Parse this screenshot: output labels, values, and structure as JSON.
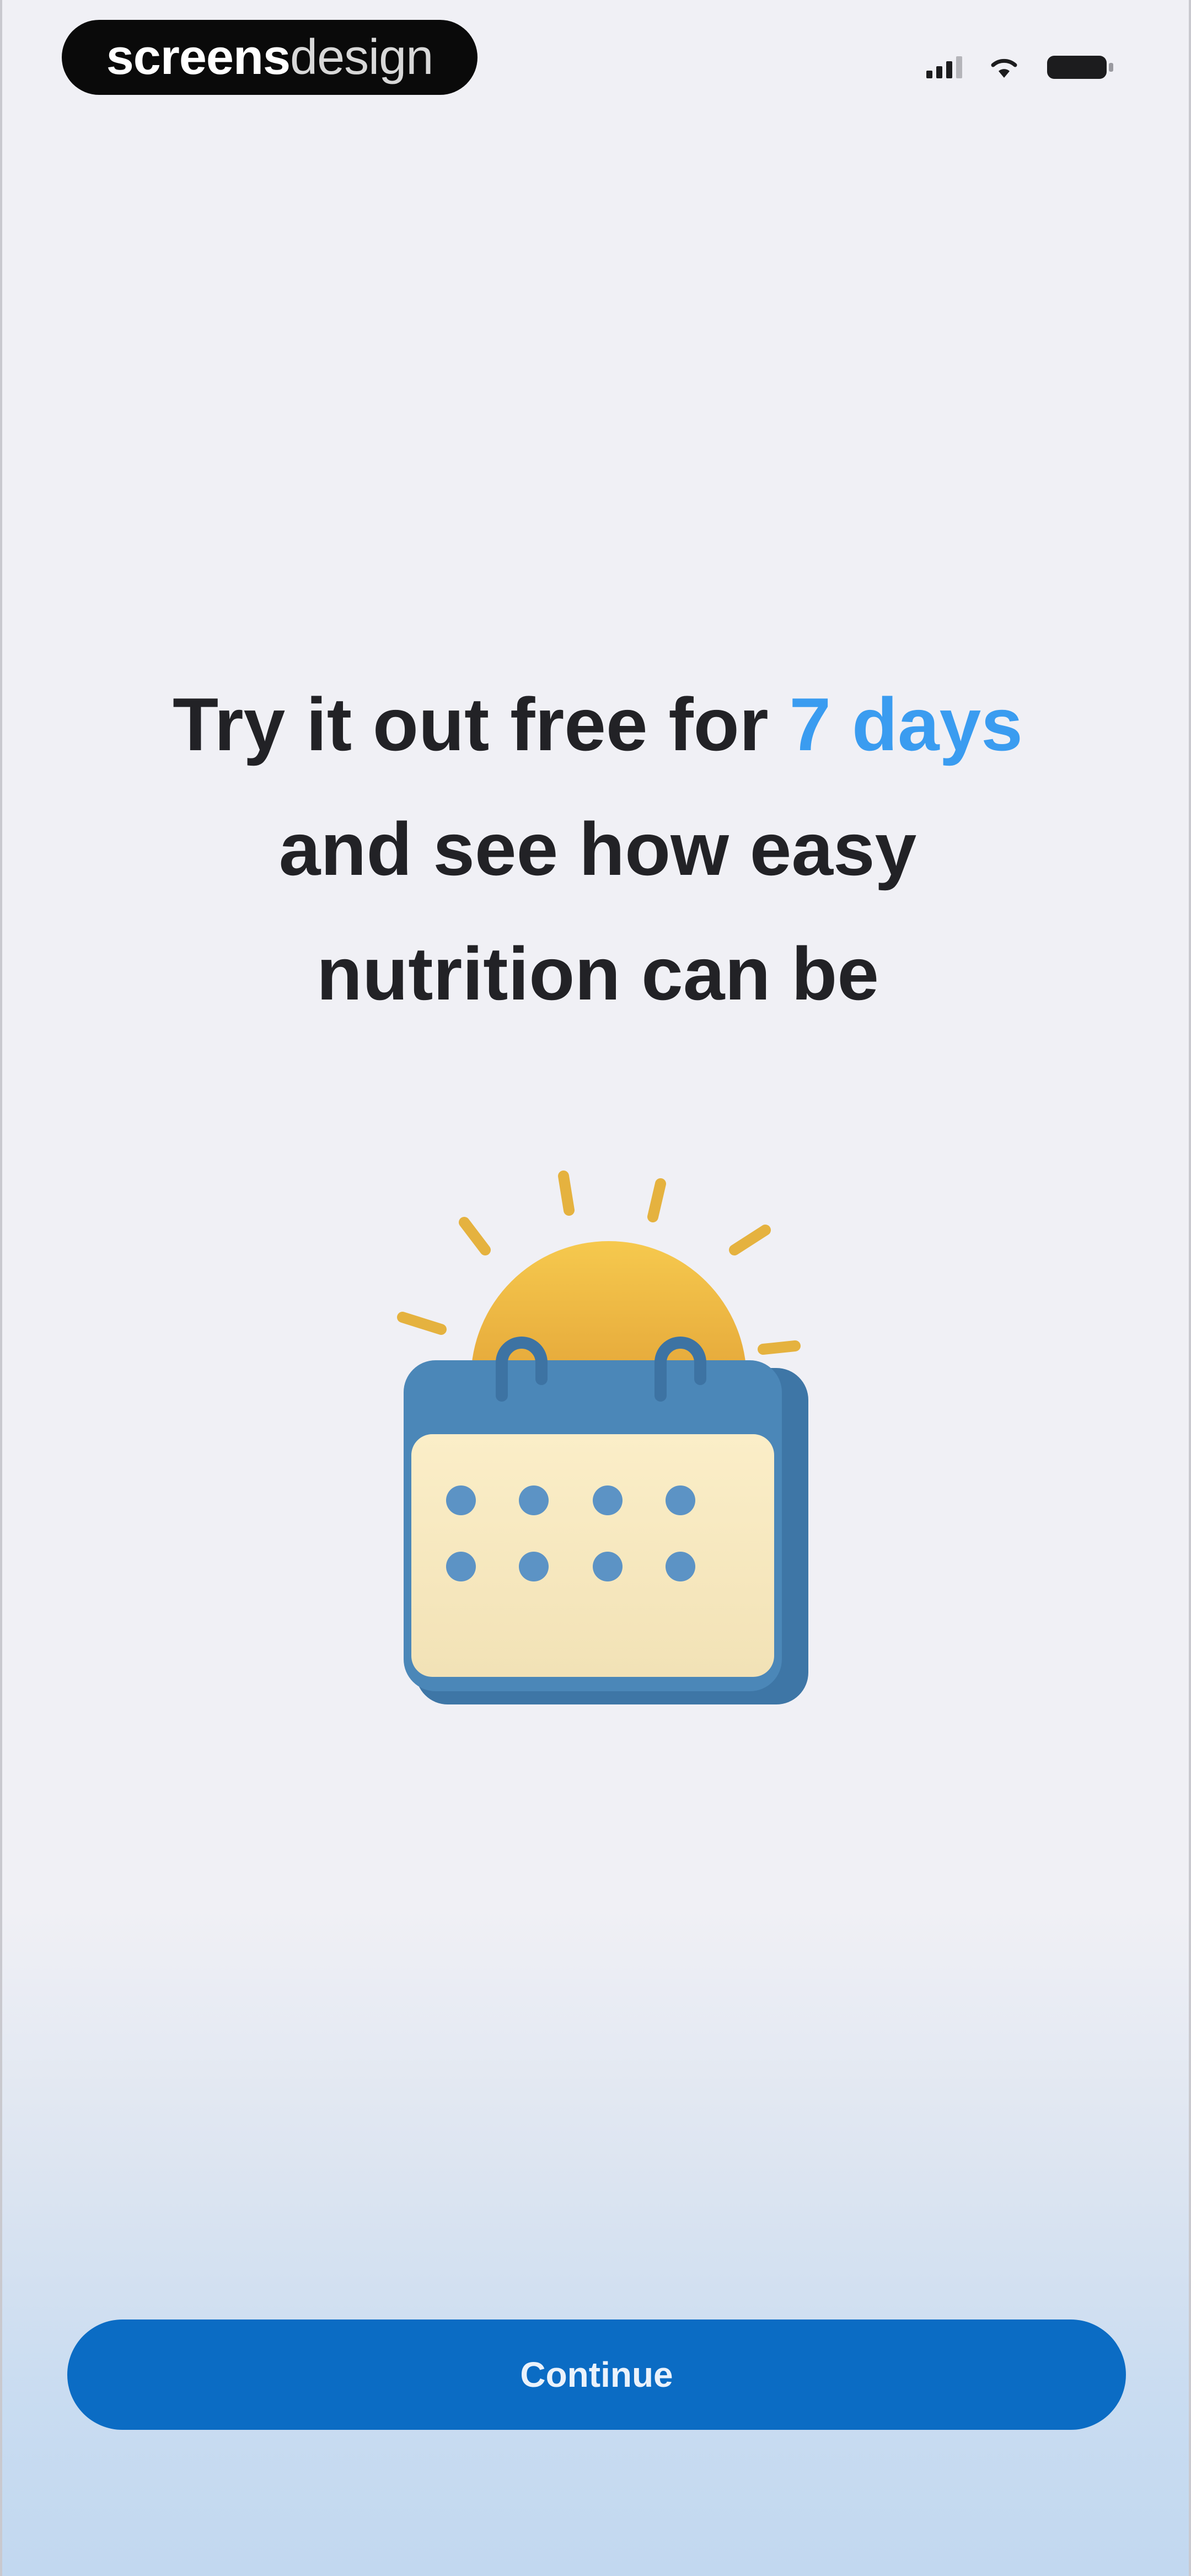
{
  "watermark": {
    "bold": "screens",
    "light": "design"
  },
  "status_bar": {
    "signal_icon": "cellular-signal-icon",
    "wifi_icon": "wifi-icon",
    "battery_icon": "battery-icon"
  },
  "headline": {
    "line1_prefix": "Try it out free for ",
    "line1_accent": "7 days",
    "line2": "and see how easy",
    "line3": "nutrition can be"
  },
  "hero": {
    "icon": "calendar-with-sun-icon"
  },
  "cta": {
    "label": "Continue"
  },
  "colors": {
    "accent": "#3a9cf0",
    "button": "#0b6cc4",
    "text": "#222226",
    "background_top": "#f0f0f5",
    "background_bottom": "#c2d8f0"
  }
}
